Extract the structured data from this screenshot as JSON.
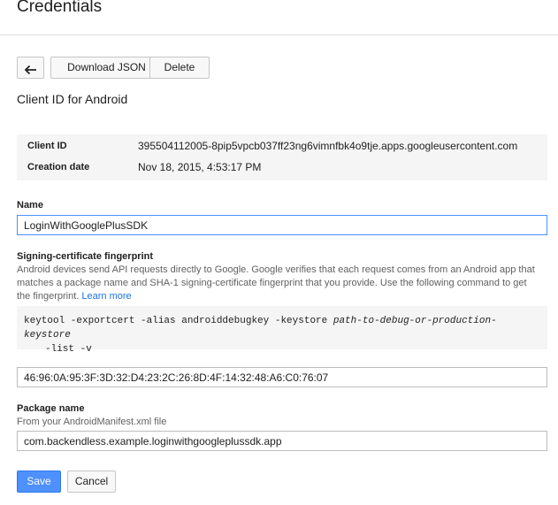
{
  "header": {
    "title": "Credentials"
  },
  "toolbar": {
    "back_icon": "arrow-back-icon",
    "download_label": "Download JSON",
    "delete_label": "Delete"
  },
  "section_title": "Client ID for Android",
  "info": {
    "client_id_label": "Client ID",
    "client_id_value": "395504112005-8pip5vpcb037ff23ng6vimnfbk4o9tje.apps.googleusercontent.com",
    "creation_date_label": "Creation date",
    "creation_date_value": "Nov 18, 2015, 4:53:17 PM"
  },
  "name_field": {
    "label": "Name",
    "value": "LoginWithGooglePlusSDK"
  },
  "fingerprint": {
    "label": "Signing-certificate fingerprint",
    "help_line1": "Android devices send API requests directly to Google. Google verifies that each request comes from an Android app that",
    "help_line2": "matches a package name and SHA-1 signing-certificate fingerprint that you provide. Use the following command to get",
    "help_line3": "the fingerprint.",
    "learn_more": "Learn more",
    "command_line1_prefix": "keytool -exportcert -alias androiddebugkey -keystore ",
    "command_line1_arg": "path-to-debug-or-production-keystore",
    "command_line2": "-list -v",
    "value": "46:96:0A:95:3F:3D:32:D4:23:2C:26:8D:4F:14:32:48:A6:C0:76:07"
  },
  "package": {
    "label": "Package name",
    "helper": "From your AndroidManifest.xml file",
    "value": "com.backendless.example.loginwithgoogleplussdk.app"
  },
  "actions": {
    "save_label": "Save",
    "cancel_label": "Cancel"
  },
  "colors": {
    "primary": "#4d90fe",
    "link": "#1a73e8",
    "panel": "#f5f5f5"
  }
}
